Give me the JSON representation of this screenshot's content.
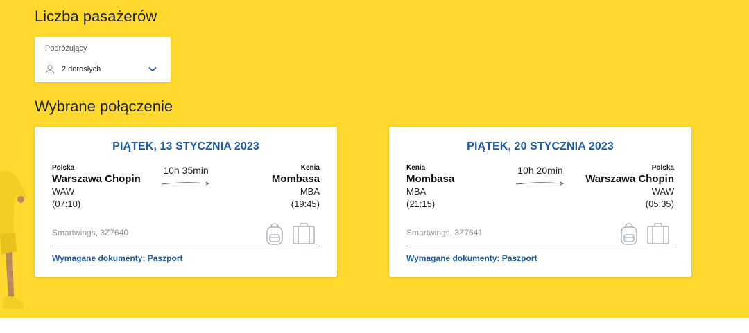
{
  "passengers": {
    "heading": "Liczba pasażerów",
    "field_label": "Podróżujący",
    "value": "2 dorosłych"
  },
  "connection": {
    "heading": "Wybrane połączenie",
    "flights": [
      {
        "date": "PIĄTEK, 13 STYCZNIA 2023",
        "from": {
          "country": "Polska",
          "city": "Warszawa Chopin",
          "code": "WAW",
          "time": "(07:10)"
        },
        "to": {
          "country": "Kenia",
          "city": "Mombasa",
          "code": "MBA",
          "time": "(19:45)"
        },
        "duration": "10h 35min",
        "airline": "Smartwings, 3Z7640",
        "documents": "Wymagane dokumenty: Paszport"
      },
      {
        "date": "PIĄTEK, 20 STYCZNIA 2023",
        "from": {
          "country": "Kenia",
          "city": "Mombasa",
          "code": "MBA",
          "time": "(21:15)"
        },
        "to": {
          "country": "Polska",
          "city": "Warszawa Chopin",
          "code": "WAW",
          "time": "(05:35)"
        },
        "duration": "10h 20min",
        "airline": "Smartwings, 3Z7641",
        "documents": "Wymagane dokumenty: Paszport"
      }
    ]
  },
  "icons": [
    "user-icon",
    "chevron-down-icon",
    "flight-arrow-icon",
    "backpack-icon",
    "suitcase-icon"
  ],
  "colors": {
    "background": "#ffd92e",
    "accent": "#1a5ba6",
    "muted": "#8a8f99"
  }
}
